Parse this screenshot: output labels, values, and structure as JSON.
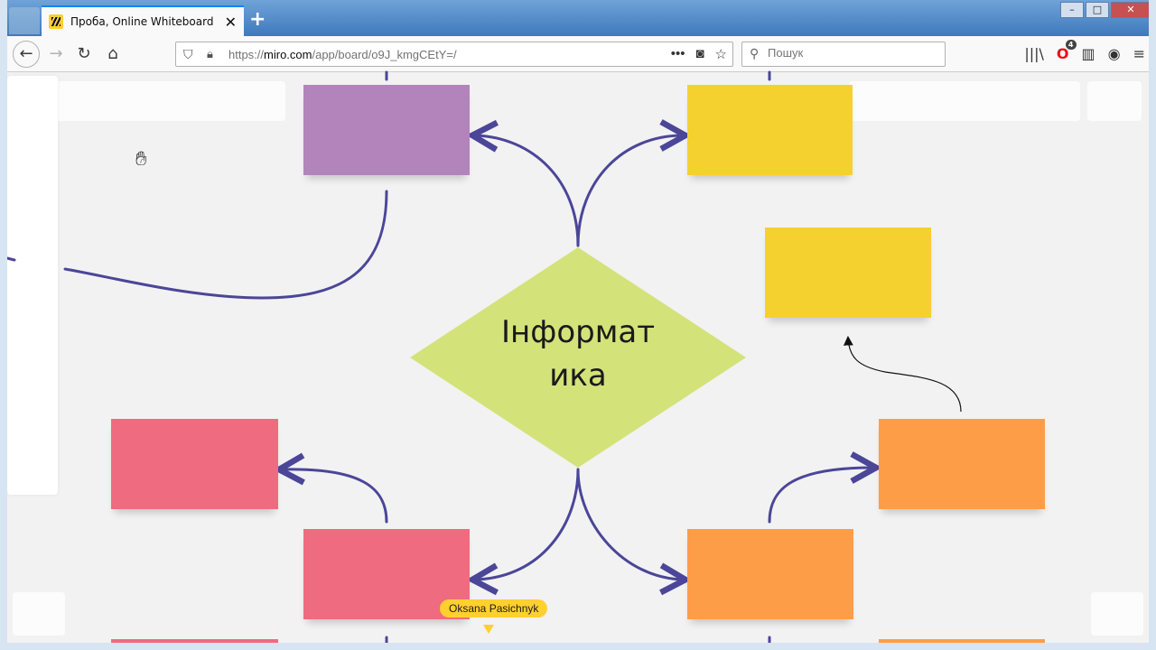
{
  "browser": {
    "tab_title": "Проба, Online Whiteboard for",
    "tab_close": "✕",
    "new_tab": "+",
    "window_controls": {
      "minimize": "–",
      "maximize": "□",
      "close": "✕"
    },
    "url_prefix": "https://",
    "url_host": "miro.com",
    "url_path": "/app/board/o9J_kmgCEtY=/",
    "search_placeholder": "Пошук",
    "menu_glyph": "≡",
    "notification_count": "4"
  },
  "board": {
    "central_node": {
      "line1": "Інформат",
      "line2": "ика",
      "color": "#d4e27a"
    },
    "connector_color": "#4b4698",
    "cursor_user": "Oksana Pasichnyk",
    "sticky_colors": {
      "purple": "#b384bb",
      "yellow": "#f5d130",
      "pink": "#ef6b7f",
      "orange": "#fe9d48"
    }
  }
}
